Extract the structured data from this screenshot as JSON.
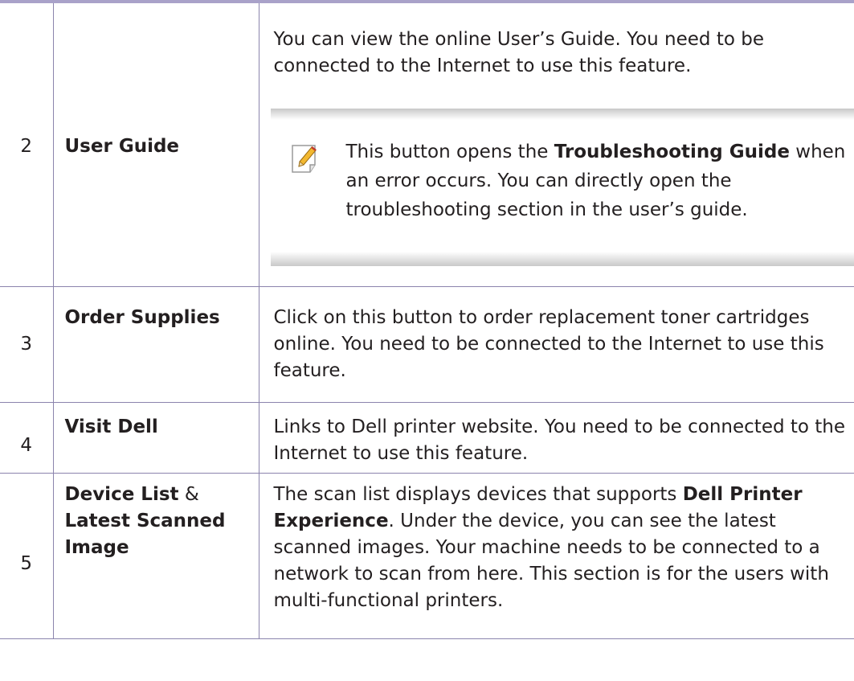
{
  "rows": [
    {
      "num": "2",
      "name": "User Guide",
      "desc": "You can view the online User’s Guide. You need to be connected to the Internet to use this feature.",
      "note": {
        "icon": "note-pencil-icon",
        "before": "This button opens the ",
        "bold": "Troubleshooting Guide",
        "after": " when an error occurs. You can directly open the troubleshooting section in the user’s guide."
      }
    },
    {
      "num": "3",
      "name": "Order Supplies",
      "desc": "Click on this button to order replacement toner cartridges online. You need to be connected to the Internet to use this feature."
    },
    {
      "num": "4",
      "name": "Visit Dell",
      "desc": "Links to Dell printer website. You need to be connected to the Internet to use this feature."
    },
    {
      "num": "5",
      "name_part1": "Device List",
      "name_amp": " & ",
      "name_part2": "Latest Scanned Image",
      "desc_before": "The scan list displays devices that supports ",
      "desc_bold": "Dell Printer Experience",
      "desc_after": ". Under the device, you can see the latest scanned images. Your machine needs to be connected to a network to scan from here. This section is for the users with multi-functional printers."
    }
  ],
  "colors": {
    "rule": "#a9a2c9",
    "border": "#8b84ad",
    "text": "#231f20",
    "note_band": "#c8c8c8"
  }
}
